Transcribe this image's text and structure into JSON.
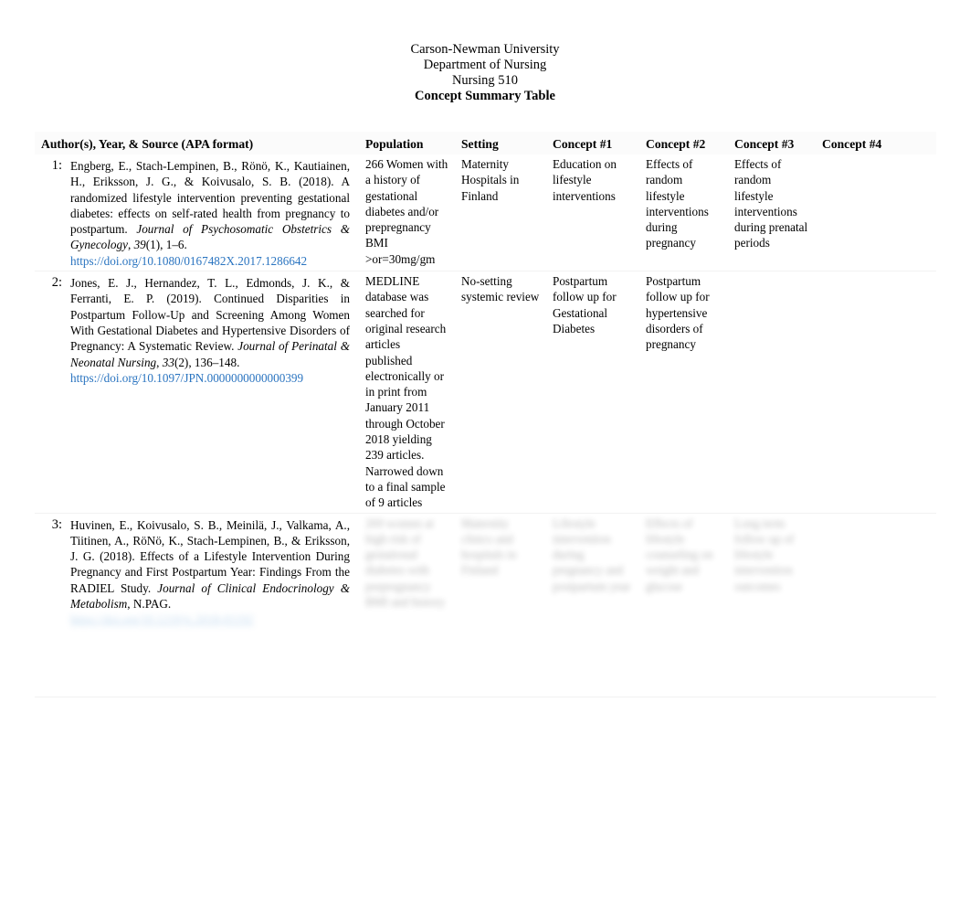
{
  "document": {
    "heading": [
      {
        "text": "Carson-Newman University",
        "bold": false
      },
      {
        "text": "Department of Nursing",
        "bold": false
      },
      {
        "text": "Nursing 510",
        "bold": false
      },
      {
        "text": "Concept Summary Table",
        "bold": true
      }
    ]
  },
  "colors": {
    "link": "#2a74c0",
    "text": "#000000",
    "row_rule": "#f2f2f2",
    "header_fill": "#fbfbfb"
  },
  "table": {
    "headers": {
      "author": "Author(s), Year, & Source (APA format)",
      "population": "Population",
      "setting": "Setting",
      "concept1": "Concept #1",
      "concept2": "Concept #2",
      "concept3": "Concept #3",
      "concept4": "Concept #4"
    },
    "rows": [
      {
        "number": "1:",
        "citation": {
          "part1": "Engberg, E., Stach-Lempinen, B., Rönö, K., Kautiainen, H., Eriksson, J. G., & Koivusalo, S. B. (2018). A randomized lifestyle intervention preventing gestational diabetes: effects on self-rated health from pregnancy to postpartum. ",
          "journal": "Journal of Psychosomatic Obstetrics & Gynecology",
          "part2": ", ",
          "volume": "39",
          "part3": "(1), 1–6. ",
          "doi": "https://doi.org/10.1080/0167482X.2017.1286642"
        },
        "population": "266 Women with a history of gestational diabetes and/or prepregnancy BMI >or=30mg/gm",
        "setting": "Maternity Hospitals in Finland",
        "concept1": "Education on lifestyle interventions",
        "concept2": "Effects of random lifestyle interventions during pregnancy",
        "concept3": "Effects of random lifestyle interventions during prenatal periods",
        "concept4": "",
        "blurred": false
      },
      {
        "number": "2:",
        "citation": {
          "part1": "Jones, E. J., Hernandez, T. L., Edmonds, J. K., & Ferranti, E. P. (2019). Continued Disparities in Postpartum Follow-Up and Screening Among Women With Gestational Diabetes and Hypertensive Disorders of Pregnancy: A Systematic Review. ",
          "journal": "Journal of Perinatal & Neonatal Nursing",
          "part2": ", ",
          "volume": "33",
          "part3": "(2), 136–148. ",
          "doi": "https://doi.org/10.1097/JPN.0000000000000399"
        },
        "population": "MEDLINE database was searched for original research articles published electronically or in print from January 2011 through October 2018 yielding 239 articles. Narrowed down to a final sample of 9 articles",
        "setting": "No-setting systemic review",
        "concept1": "Postpartum follow up for Gestational Diabetes",
        "concept2": "Postpartum follow up for hypertensive disorders of pregnancy",
        "concept3": "",
        "concept4": "",
        "blurred": false
      },
      {
        "number": "3:",
        "citation": {
          "part1": "Huvinen, E., Koivusalo, S. B., Meinilä, J., Valkama, A., Tiitinen, A., RöNö, K., Stach-Lempinen, B., & Eriksson, J. G. (2018). Effects of a Lifestyle Intervention During Pregnancy and First Postpartum Year: Findings From the RADIEL Study. ",
          "journal": "Journal of Clinical Endocrinology & Metabolism",
          "part2": ", ",
          "volume": "",
          "part3": "N.PAG. ",
          "doi": "https://doi.org/10.1210/jc.2018-01192"
        },
        "population": "269 women at high risk of gestational diabetes with prepregnancy BMI and history",
        "setting": "Maternity clinics and hospitals in Finland",
        "concept1": "Lifestyle intervention during pregnancy and postpartum year",
        "concept2": "Effects of lifestyle counseling on weight and glucose",
        "concept3": "Long term follow up of lifestyle intervention outcomes",
        "concept4": "",
        "blurred": true
      }
    ]
  }
}
